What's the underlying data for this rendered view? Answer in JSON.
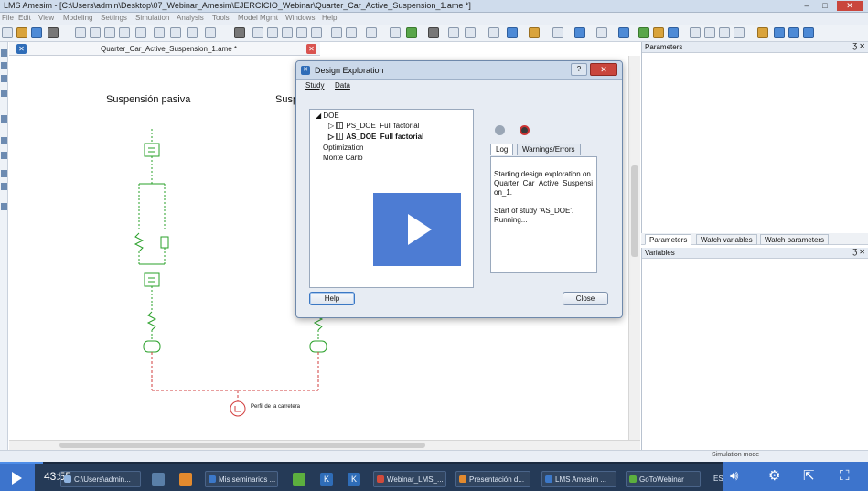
{
  "window": {
    "title": "LMS Amesim - [C:\\Users\\admin\\Desktop\\07_Webinar_Amesim\\EJERCICIO_Webinar\\Quarter_Car_Active_Suspension_1.ame *]"
  },
  "menu": [
    "File",
    "Edit",
    "View",
    "Modeling",
    "Settings",
    "Simulation",
    "Analysis",
    "Tools",
    "Model Mgmt",
    "Windows",
    "Help"
  ],
  "document": {
    "tab_label": "Quarter_Car_Active_Suspension_1.ame *"
  },
  "sketch": {
    "label_passive": "Suspensión pasiva",
    "label_active": "Susp",
    "road_label": "Perfil de la carretera"
  },
  "panels": {
    "parameters_title": "Parameters",
    "variables_title": "Variables",
    "tabs": [
      "Parameters",
      "Watch variables",
      "Watch parameters"
    ],
    "dock_glyph": "Ʒ ✕"
  },
  "dialog": {
    "title": "Design Exploration",
    "help_glyph": "?",
    "close_glyph": "✕",
    "menu": [
      "Study",
      "Data"
    ],
    "tree": {
      "doe": "DOE",
      "ps_doe_name": "PS_DOE",
      "ps_doe_type": "Full factorial",
      "as_doe_name": "AS_DOE",
      "as_doe_type": "Full factorial",
      "optimization": "Optimization",
      "monte_carlo": "Monte Carlo"
    },
    "tabs": [
      "Log",
      "Warnings/Errors"
    ],
    "log_line1": "Starting design exploration on Quarter_Car_Active_Suspension_1.",
    "log_line2": "Start of study 'AS_DOE'.",
    "log_line3": "Running...",
    "help_button": "Help",
    "close_button": "Close"
  },
  "statusbar": {
    "simulation_mode": "Simulation mode"
  },
  "video": {
    "time": "43:55",
    "progress": 0.05
  },
  "taskbar": {
    "items": [
      "C:\\Users\\admin...",
      "Mis seminarios ...",
      "Webinar_LMS_...",
      "Presentación d...",
      "LMS Amesim ...",
      "GoToWebinar"
    ],
    "lang": "ES"
  },
  "colors": {
    "accent": "#3d74cc",
    "component_green": "#2aa02a",
    "road_red": "#d23c3c"
  }
}
